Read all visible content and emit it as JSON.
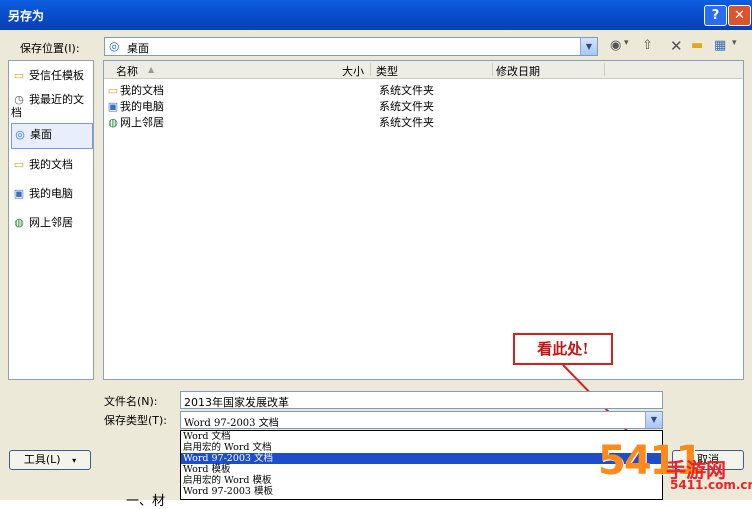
{
  "window": {
    "title": "另存为"
  },
  "toolbar": {
    "save_in_label": "保存位置(I):",
    "save_in_value": "桌面"
  },
  "places": [
    {
      "label": "受信任模板",
      "icon": "folder-icon"
    },
    {
      "label": "我最近的文档",
      "icon": "recent-docs-icon"
    },
    {
      "label": "桌面",
      "icon": "desktop-icon",
      "selected": true
    },
    {
      "label": "我的文档",
      "icon": "my-documents-icon"
    },
    {
      "label": "我的电脑",
      "icon": "my-computer-icon"
    },
    {
      "label": "网上邻居",
      "icon": "network-places-icon"
    }
  ],
  "columns": {
    "name": "名称",
    "size": "大小",
    "type": "类型",
    "modified": "修改日期"
  },
  "files": [
    {
      "name": "我的文档",
      "type": "系统文件夹",
      "icon": "my-documents-icon"
    },
    {
      "name": "我的电脑",
      "type": "系统文件夹",
      "icon": "my-computer-icon"
    },
    {
      "name": "网上邻居",
      "type": "系统文件夹",
      "icon": "network-places-icon"
    }
  ],
  "form": {
    "filename_label": "文件名(N):",
    "filename_value": "2013年国家发展改革",
    "filetype_label": "保存类型(T):",
    "filetype_value": "Word 97-2003 文档"
  },
  "filetype_options": [
    "Word 文档",
    "启用宏的 Word 文档",
    "Word 97-2003 文档",
    "Word 模板",
    "启用宏的 Word 模板",
    "Word 97-2003 模板"
  ],
  "filetype_selected_index": 2,
  "buttons": {
    "tools": "工具(L)",
    "cancel": "取消"
  },
  "annotation": {
    "callout": "看此处!"
  },
  "watermark": {
    "big": "5411",
    "text": "手游网",
    "url": "5411.com.cn"
  },
  "below_text": "一、材"
}
